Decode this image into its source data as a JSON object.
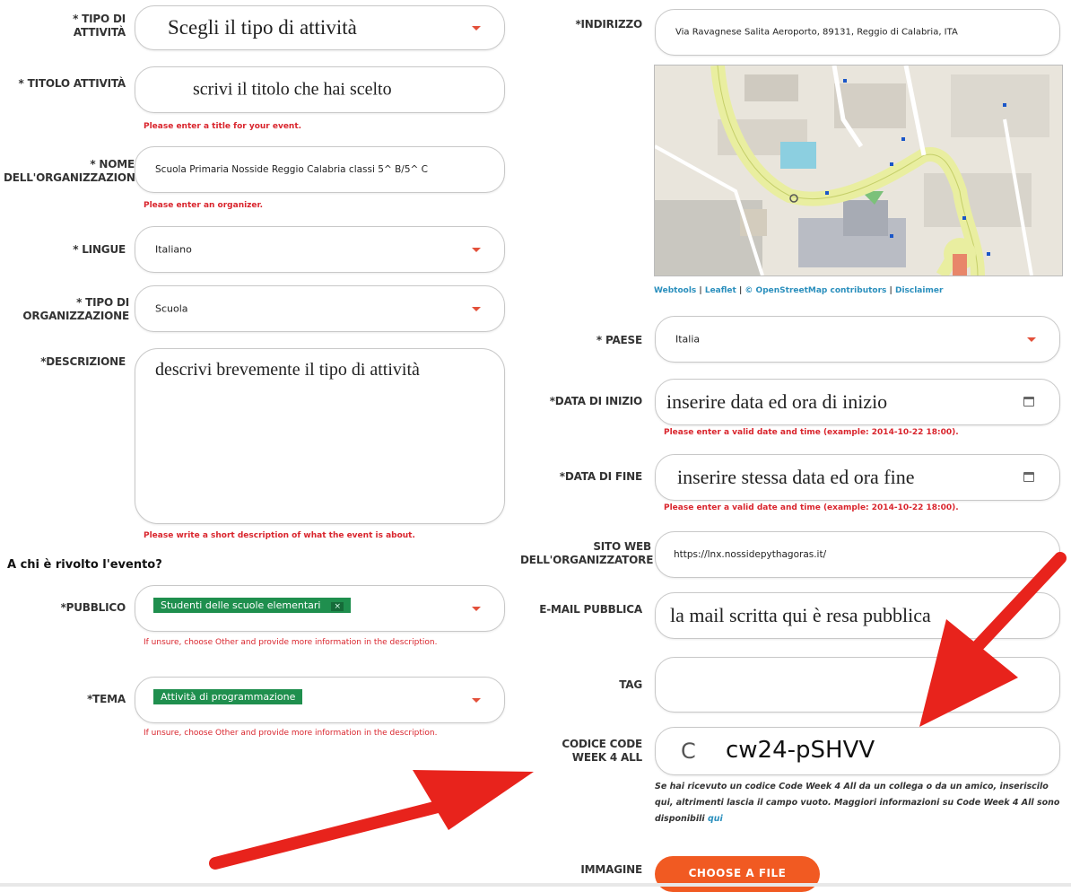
{
  "left": {
    "tipo_attivita": {
      "label": "* TIPO DI ATTIVITÀ",
      "value": "Scegli il tipo di attività"
    },
    "titolo": {
      "label": "* TITOLO ATTIVITÀ",
      "value": "scrivi il titolo che hai scelto",
      "error": "Please enter a title for your event."
    },
    "organizzatore": {
      "label": "* NOME DELL'ORGANIZZAZIONE",
      "value": "Scuola Primaria Nosside Reggio Calabria classi 5^ B/5^ C",
      "error": "Please enter an organizer."
    },
    "lingue": {
      "label": "* LINGUE",
      "value": "Italiano"
    },
    "tipo_org": {
      "label": "* TIPO DI ORGANIZZAZIONE",
      "value": "Scuola"
    },
    "descrizione": {
      "label": "*DESCRIZIONE",
      "value": "descrivi brevemente il tipo di attività",
      "error": "Please write a short description of what the event is about."
    },
    "section_heading": "A chi è rivolto l'evento?",
    "pubblico": {
      "label": "*PUBBLICO",
      "chip": "Studenti delle scuole elementari",
      "chip_remove": "×",
      "hint": "If unsure, choose Other and provide more information in the description."
    },
    "tema": {
      "label": "*TEMA",
      "chip": "Attività di programmazione",
      "hint": "If unsure, choose Other and provide more information in the description."
    }
  },
  "right": {
    "indirizzo": {
      "label": "*INDIRIZZO",
      "value": "Via Ravagnese Salita Aeroporto, 89131, Reggio di Calabria, ITA"
    },
    "map_attribution": {
      "webtools": "Webtools",
      "leaflet": "Leaflet",
      "osm": "© OpenStreetMap contributors",
      "disclaimer": "Disclaimer",
      "sep": "|"
    },
    "paese": {
      "label": "* PAESE",
      "value": "Italia"
    },
    "data_inizio": {
      "label": "*DATA DI INIZIO",
      "value": "inserire data ed ora di inizio",
      "error": "Please enter a valid date and time (example: 2014-10-22 18:00)."
    },
    "data_fine": {
      "label": "*DATA DI FINE",
      "value": "inserire stessa data ed ora fine",
      "error": "Please enter a valid date and time (example: 2014-10-22 18:00)."
    },
    "sito_web": {
      "label": "SITO WEB DELL'ORGANIZZATORE",
      "value": "https://lnx.nossidepythagoras.it/"
    },
    "email": {
      "label": "E-MAIL PUBBLICA",
      "value": "la mail scritta qui è resa pubblica"
    },
    "tag": {
      "label": "TAG",
      "value": ""
    },
    "codice": {
      "label": "CODICE CODE WEEK 4 ALL",
      "prefix": "C",
      "value": "cw24-pSHVV"
    },
    "codice_note": "Se hai ricevuto un codice Code Week 4 All da un collega o da un amico, inseriscilo qui, altrimenti lascia il campo vuoto. Maggiori informazioni su Code Week 4 All sono disponibili",
    "codice_note_link": "qui",
    "immagine": {
      "label": "IMMAGINE",
      "button": "CHOOSE A FILE"
    }
  },
  "colors": {
    "accent": "#f15a22",
    "error": "#d9252d",
    "chip": "#1f8f4e",
    "arrow": "#e8231c",
    "link": "#2a8fbd"
  }
}
